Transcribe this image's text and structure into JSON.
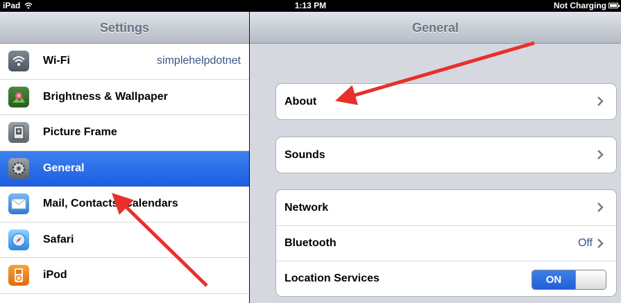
{
  "status_bar": {
    "device": "iPad",
    "time": "1:13 PM",
    "battery_text": "Not Charging"
  },
  "master": {
    "title": "Settings",
    "items": [
      {
        "label": "Wi-Fi",
        "detail": "simplehelpdotnet",
        "icon": "wifi-icon"
      },
      {
        "label": "Brightness & Wallpaper",
        "icon": "brightness-wallpaper-icon"
      },
      {
        "label": "Picture Frame",
        "icon": "picture-frame-icon"
      },
      {
        "label": "General",
        "icon": "gear-icon",
        "selected": true
      },
      {
        "label": "Mail, Contacts, Calendars",
        "icon": "mail-icon"
      },
      {
        "label": "Safari",
        "icon": "safari-compass-icon"
      },
      {
        "label": "iPod",
        "icon": "ipod-icon"
      }
    ]
  },
  "detail": {
    "title": "General",
    "groups": [
      {
        "cells": [
          {
            "label": "About"
          }
        ]
      },
      {
        "cells": [
          {
            "label": "Sounds"
          }
        ]
      },
      {
        "cells": [
          {
            "label": "Network"
          },
          {
            "label": "Bluetooth",
            "value": "Off"
          },
          {
            "label": "Location Services",
            "toggle": "ON"
          }
        ]
      }
    ]
  },
  "colors": {
    "selection_blue": "#2a6de9",
    "annotation_arrow": "#e8302a",
    "detail_value": "#385487"
  }
}
